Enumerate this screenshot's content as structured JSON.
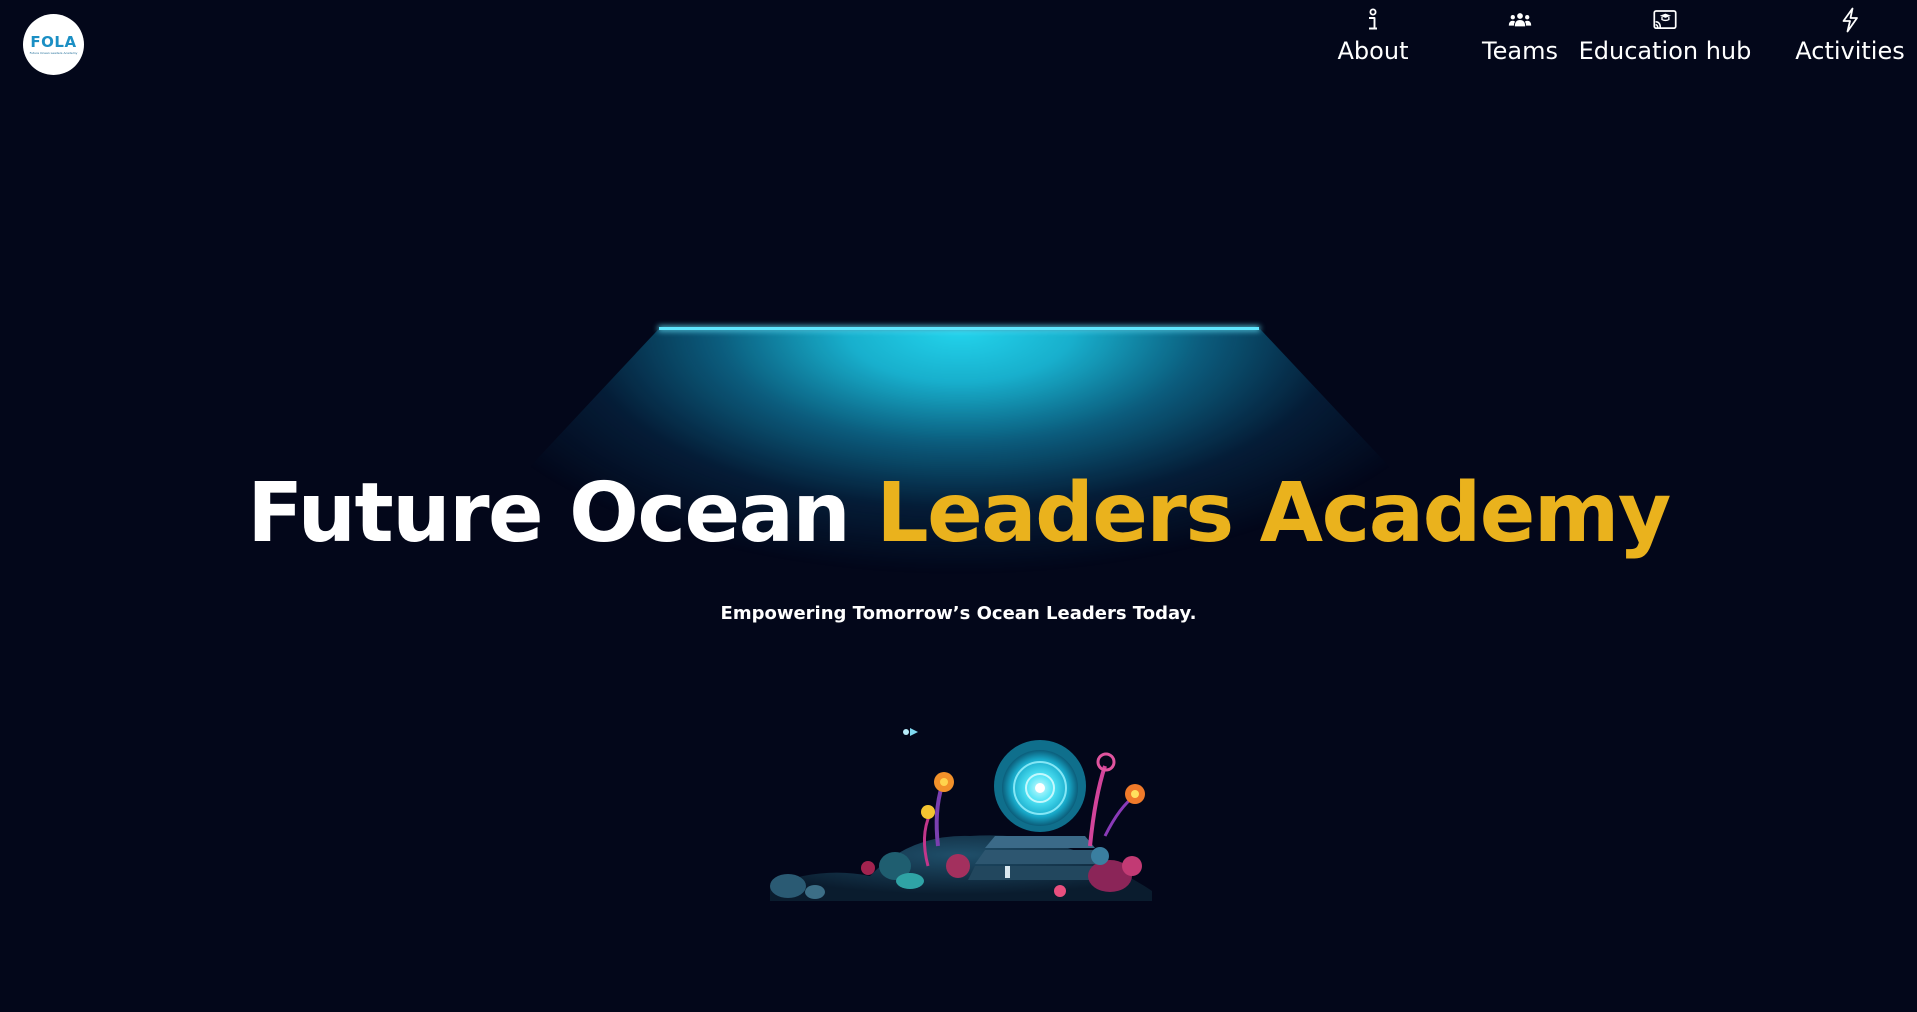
{
  "header": {
    "logo": {
      "text": "FOLA",
      "tagline": "Future Ocean Leaders Academy"
    },
    "nav": [
      {
        "label": "About",
        "icon": "info-icon"
      },
      {
        "label": "Teams",
        "icon": "users-icon"
      },
      {
        "label": "Education hub",
        "icon": "cast-graduation-icon"
      },
      {
        "label": "Activities",
        "icon": "lightning-icon"
      }
    ]
  },
  "hero": {
    "title_part1": "Future Ocean",
    "title_part2": "Leaders Academy",
    "subtitle": "Empowering Tomorrow’s Ocean Leaders Today.",
    "illustration": "underwater-portal-illustration"
  },
  "colors": {
    "background": "#03071a",
    "accent_gold": "#eab21d",
    "light_cyan": "#23d4ed"
  }
}
